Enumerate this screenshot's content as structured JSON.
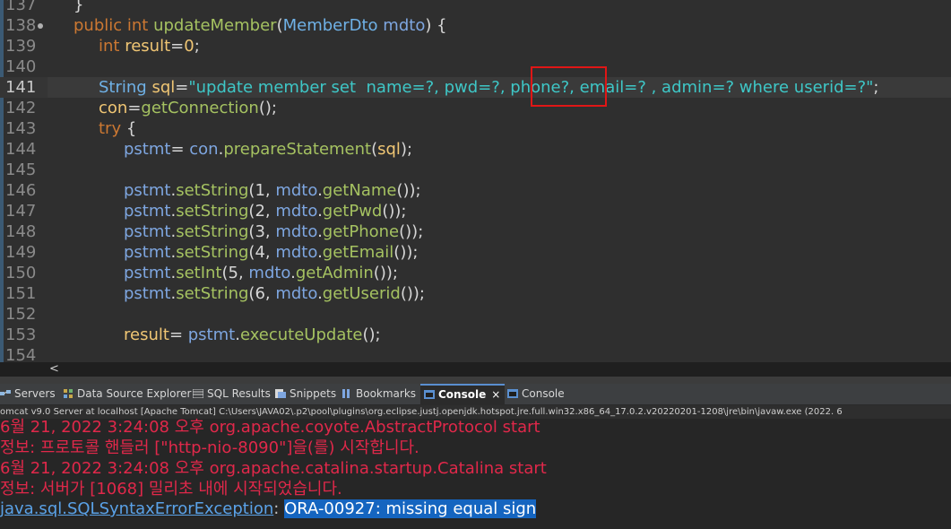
{
  "editor": {
    "lines": [
      {
        "n": "137",
        "tokens": [
          {
            "t": "}",
            "c": "pl"
          }
        ]
      },
      {
        "n": "138",
        "tokens": [
          {
            "t": "public ",
            "c": "kw"
          },
          {
            "t": "int ",
            "c": "kw"
          },
          {
            "t": "updateMember",
            "c": "fn"
          },
          {
            "t": "(",
            "c": "pl"
          },
          {
            "t": "MemberDto ",
            "c": "ty"
          },
          {
            "t": "mdto",
            "c": "mb"
          },
          {
            "t": ") {",
            "c": "pl"
          }
        ]
      },
      {
        "n": "139",
        "tokens": [
          {
            "t": "int ",
            "c": "kw"
          },
          {
            "t": "result",
            "c": "va"
          },
          {
            "t": "=",
            "c": "pl"
          },
          {
            "t": "0",
            "c": "va"
          },
          {
            "t": ";",
            "c": "pl"
          }
        ]
      },
      {
        "n": "140",
        "tokens": []
      },
      {
        "n": "141",
        "tokens": [
          {
            "t": "String ",
            "c": "ty"
          },
          {
            "t": "sql",
            "c": "va"
          },
          {
            "t": "=",
            "c": "pl"
          },
          {
            "t": "\"update member set  name=?, pwd=?, phone?, email=? , admin=? where userid=?\"",
            "c": "st"
          },
          {
            "t": ";",
            "c": "pl"
          }
        ]
      },
      {
        "n": "142",
        "tokens": [
          {
            "t": "con",
            "c": "va"
          },
          {
            "t": "=",
            "c": "pl"
          },
          {
            "t": "getConnection",
            "c": "fn"
          },
          {
            "t": "();",
            "c": "pl"
          }
        ]
      },
      {
        "n": "143",
        "tokens": [
          {
            "t": "try ",
            "c": "kw"
          },
          {
            "t": "{",
            "c": "pl"
          }
        ]
      },
      {
        "n": "144",
        "tokens": [
          {
            "t": "pstmt",
            "c": "mb"
          },
          {
            "t": "= ",
            "c": "pl"
          },
          {
            "t": "con",
            "c": "mb"
          },
          {
            "t": ".",
            "c": "pl"
          },
          {
            "t": "prepareStatement",
            "c": "fn"
          },
          {
            "t": "(",
            "c": "pl"
          },
          {
            "t": "sql",
            "c": "va"
          },
          {
            "t": ");",
            "c": "pl"
          }
        ]
      },
      {
        "n": "145",
        "tokens": []
      },
      {
        "n": "146",
        "tokens": [
          {
            "t": "pstmt",
            "c": "mb"
          },
          {
            "t": ".",
            "c": "pl"
          },
          {
            "t": "setString",
            "c": "fn"
          },
          {
            "t": "(1, ",
            "c": "pl"
          },
          {
            "t": "mdto",
            "c": "mb"
          },
          {
            "t": ".",
            "c": "pl"
          },
          {
            "t": "getName",
            "c": "fn"
          },
          {
            "t": "());",
            "c": "pl"
          }
        ]
      },
      {
        "n": "147",
        "tokens": [
          {
            "t": "pstmt",
            "c": "mb"
          },
          {
            "t": ".",
            "c": "pl"
          },
          {
            "t": "setString",
            "c": "fn"
          },
          {
            "t": "(2, ",
            "c": "pl"
          },
          {
            "t": "mdto",
            "c": "mb"
          },
          {
            "t": ".",
            "c": "pl"
          },
          {
            "t": "getPwd",
            "c": "fn"
          },
          {
            "t": "());",
            "c": "pl"
          }
        ]
      },
      {
        "n": "148",
        "tokens": [
          {
            "t": "pstmt",
            "c": "mb"
          },
          {
            "t": ".",
            "c": "pl"
          },
          {
            "t": "setString",
            "c": "fn"
          },
          {
            "t": "(3, ",
            "c": "pl"
          },
          {
            "t": "mdto",
            "c": "mb"
          },
          {
            "t": ".",
            "c": "pl"
          },
          {
            "t": "getPhone",
            "c": "fn"
          },
          {
            "t": "());",
            "c": "pl"
          }
        ]
      },
      {
        "n": "149",
        "tokens": [
          {
            "t": "pstmt",
            "c": "mb"
          },
          {
            "t": ".",
            "c": "pl"
          },
          {
            "t": "setString",
            "c": "fn"
          },
          {
            "t": "(4, ",
            "c": "pl"
          },
          {
            "t": "mdto",
            "c": "mb"
          },
          {
            "t": ".",
            "c": "pl"
          },
          {
            "t": "getEmail",
            "c": "fn"
          },
          {
            "t": "());",
            "c": "pl"
          }
        ]
      },
      {
        "n": "150",
        "tokens": [
          {
            "t": "pstmt",
            "c": "mb"
          },
          {
            "t": ".",
            "c": "pl"
          },
          {
            "t": "setInt",
            "c": "fn"
          },
          {
            "t": "(5, ",
            "c": "pl"
          },
          {
            "t": "mdto",
            "c": "mb"
          },
          {
            "t": ".",
            "c": "pl"
          },
          {
            "t": "getAdmin",
            "c": "fn"
          },
          {
            "t": "());",
            "c": "pl"
          }
        ]
      },
      {
        "n": "151",
        "tokens": [
          {
            "t": "pstmt",
            "c": "mb"
          },
          {
            "t": ".",
            "c": "pl"
          },
          {
            "t": "setString",
            "c": "fn"
          },
          {
            "t": "(6, ",
            "c": "pl"
          },
          {
            "t": "mdto",
            "c": "mb"
          },
          {
            "t": ".",
            "c": "pl"
          },
          {
            "t": "getUserid",
            "c": "fn"
          },
          {
            "t": "());",
            "c": "pl"
          }
        ]
      },
      {
        "n": "152",
        "tokens": []
      },
      {
        "n": "153",
        "tokens": [
          {
            "t": "result",
            "c": "va"
          },
          {
            "t": "= ",
            "c": "pl"
          },
          {
            "t": "pstmt",
            "c": "mb"
          },
          {
            "t": ".",
            "c": "pl"
          },
          {
            "t": "executeUpdate",
            "c": "fn"
          },
          {
            "t": "();",
            "c": "pl"
          }
        ]
      },
      {
        "n": "154",
        "tokens": []
      }
    ],
    "scroll_left_glyph": "<"
  },
  "views": {
    "tabs": [
      {
        "label": "Servers",
        "icon": "servers-icon"
      },
      {
        "label": "Data Source Explorer",
        "icon": "data-source-icon"
      },
      {
        "label": "SQL Results",
        "icon": "sql-results-icon"
      },
      {
        "label": "Snippets",
        "icon": "snippets-icon"
      },
      {
        "label": "Bookmarks",
        "icon": "bookmarks-icon"
      },
      {
        "label": "Console",
        "icon": "console-icon",
        "close": "×"
      },
      {
        "label": "Console",
        "icon": "console-icon"
      }
    ]
  },
  "console": {
    "description": "omcat v9.0 Server at localhost [Apache Tomcat] C:\\Users\\JAVA02\\.p2\\pool\\plugins\\org.eclipse.justj.openjdk.hotspot.jre.full.win32.x86_64_17.0.2.v20220201-1208\\jre\\bin\\javaw.exe  (2022. 6",
    "lines": [
      "6월 21, 2022 3:24:08 오후 org.apache.coyote.AbstractProtocol start",
      "정보: 프로토콜 핸들러 [\"http-nio-8090\"]을(를) 시작합니다.",
      "6월 21, 2022 3:24:08 오후 org.apache.catalina.startup.Catalina start",
      "정보: 서버가 [1068] 밀리초 내에 시작되었습니다."
    ],
    "error": {
      "exception": "java.sql.SQLSyntaxErrorException",
      "separator": ": ",
      "message": "ORA-00927: missing equal sign"
    }
  },
  "colors": {
    "highlight_box": "#e01616",
    "error_text": "#e0284a",
    "selection": "#1565c0"
  }
}
